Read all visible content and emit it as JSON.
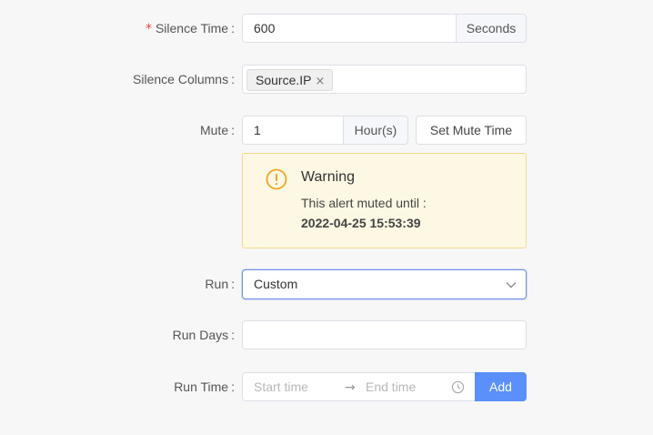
{
  "form": {
    "silence_time": {
      "required_mark": "*",
      "label": "Silence Time",
      "value": "600",
      "unit": "Seconds"
    },
    "silence_columns": {
      "label": "Silence Columns",
      "tags": [
        "Source.IP"
      ],
      "tag_close": "×"
    },
    "mute": {
      "label": "Mute",
      "value": "1",
      "unit": "Hour(s)",
      "button": "Set Mute Time"
    },
    "warning": {
      "title": "Warning",
      "message": "This alert muted until :",
      "until": "2022-04-25 15:53:39",
      "icon": "exclamation-circle-icon",
      "color": "#f0a620"
    },
    "run": {
      "label": "Run",
      "selected": "Custom"
    },
    "run_days": {
      "label": "Run Days",
      "value": ""
    },
    "run_time": {
      "label": "Run Time",
      "start_placeholder": "Start time",
      "separator": "→",
      "end_placeholder": "End time",
      "add_button": "Add"
    }
  },
  "colors": {
    "accent": "#5b8ff9",
    "required": "#e54545",
    "warning_bg": "#fdf8e4",
    "warning_border": "#f5d98b"
  },
  "colon": ":"
}
